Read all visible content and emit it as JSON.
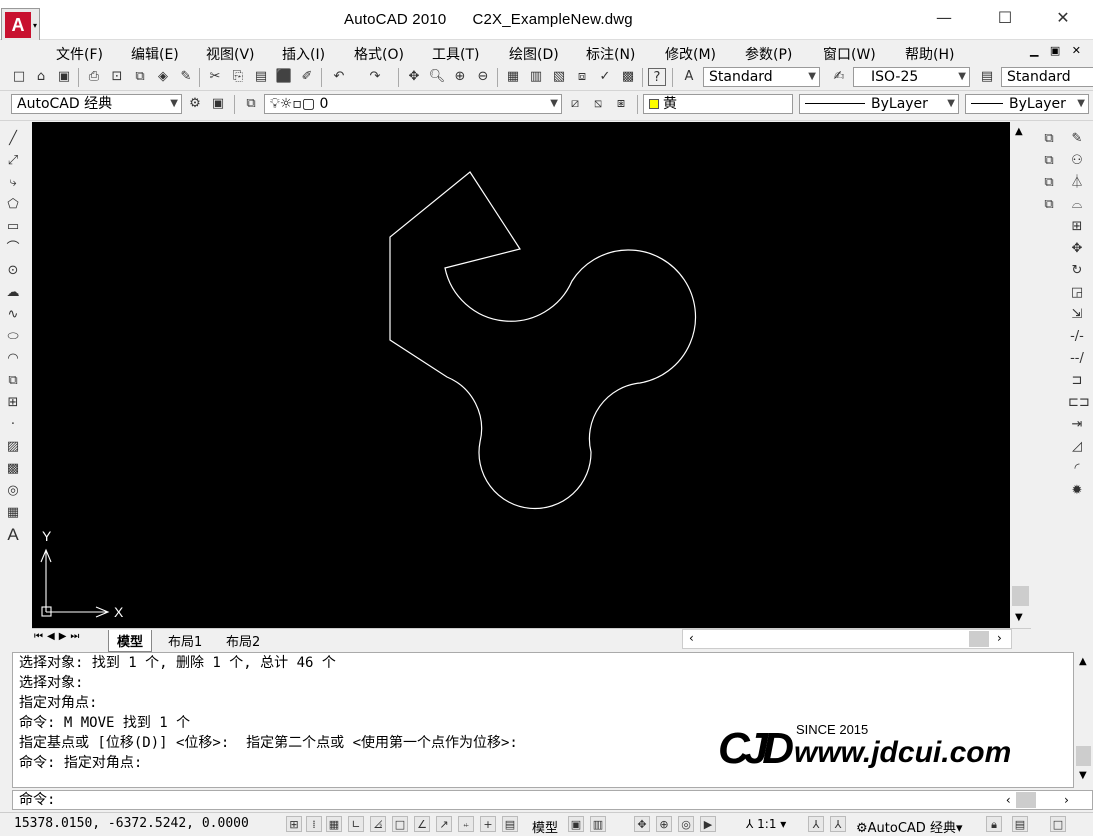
{
  "title": {
    "app": "AutoCAD 2010",
    "file": "C2X_ExampleNew.dwg"
  },
  "window_controls": {
    "minimize": "—",
    "maximize": "☐",
    "close": "✕"
  },
  "menu": [
    "文件(F)",
    "编辑(E)",
    "视图(V)",
    "插入(I)",
    "格式(O)",
    "工具(T)",
    "绘图(D)",
    "标注(N)",
    "修改(M)",
    "参数(P)",
    "窗口(W)",
    "帮助(H)"
  ],
  "styles_toolbar": {
    "text_style": "Standard",
    "dim_style": "ISO-25",
    "table_style": "Standard"
  },
  "workspace": {
    "name": "AutoCAD 经典"
  },
  "layer": {
    "current": "0"
  },
  "properties": {
    "color": "黄",
    "linetype": "ByLayer",
    "lineweight": "ByLayer"
  },
  "ucs": {
    "y_label": "Y",
    "x_label": "X"
  },
  "tabs": [
    "模型",
    "布局1",
    "布局2"
  ],
  "command_history": [
    "选择对象: 找到 1 个, 删除 1 个, 总计 46 个",
    "选择对象:",
    "指定对角点:",
    "命令: M MOVE 找到 1 个",
    "指定基点或 [位移(D)] <位移>:  指定第二个点或 <使用第一个点作为位移>:",
    "命令: 指定对角点:"
  ],
  "command_prompt": "命令:",
  "status": {
    "coords": "15378.0150,  -6372.5242,  0.0000",
    "model": "模型",
    "scale": "1:1",
    "workspace": "AutoCAD 经典"
  },
  "watermark": {
    "since": "SINCE 2015",
    "url": "www.jdcui.com",
    "logo": "CJD"
  },
  "colors": {
    "canvas": "#000000",
    "geometry": "#ffffff",
    "color_swatch": "#ffff00"
  },
  "icons": {
    "left_draw": [
      "line-icon",
      "construction-line-icon",
      "polyline-icon",
      "polygon-icon",
      "rectangle-icon",
      "arc-icon",
      "circle-icon",
      "revcloud-icon",
      "spline-icon",
      "ellipse-icon",
      "ellipse-arc-icon",
      "insert-block-icon",
      "make-block-icon",
      "point-icon",
      "hatch-icon",
      "gradient-icon",
      "region-icon",
      "table-icon",
      "mtext-icon"
    ],
    "right_modify": [
      "erase-icon",
      "copy-icon",
      "mirror-icon",
      "offset-icon",
      "array-icon",
      "move-icon",
      "rotate-icon",
      "scale-icon",
      "stretch-icon",
      "trim-icon",
      "extend-icon",
      "break-at-point-icon",
      "break-icon",
      "join-icon",
      "chamfer-icon",
      "fillet-icon",
      "explode-icon"
    ]
  }
}
